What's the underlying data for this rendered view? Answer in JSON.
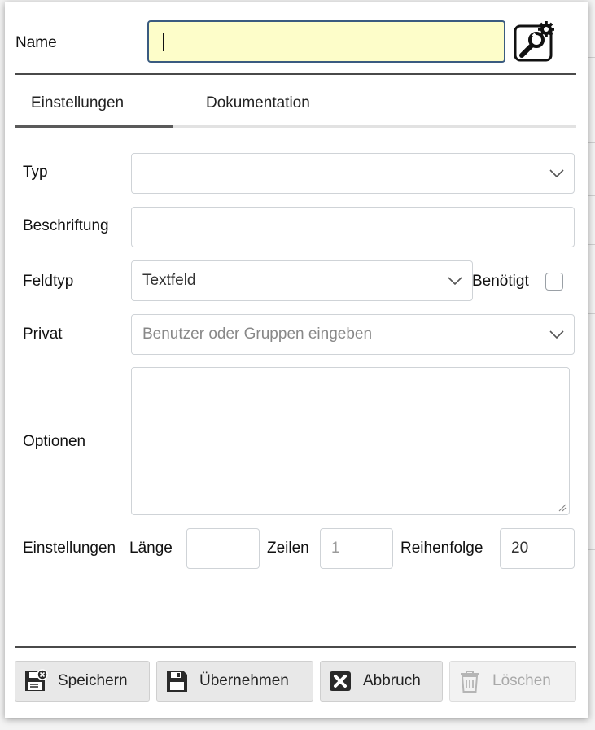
{
  "dialog": {
    "name_label": "Name",
    "name_value": "",
    "tool_icon": "wrench-gear-icon"
  },
  "tabs": [
    {
      "label": "Einstellungen",
      "active": true
    },
    {
      "label": "Dokumentation",
      "active": false
    }
  ],
  "fields": {
    "typ": {
      "label": "Typ",
      "value": ""
    },
    "beschriftung": {
      "label": "Beschriftung",
      "value": ""
    },
    "feldtyp": {
      "label": "Feldtyp",
      "value": "Textfeld"
    },
    "benoetigt": {
      "label": "Benötigt",
      "checked": false
    },
    "privat": {
      "label": "Privat",
      "placeholder": "Benutzer oder Gruppen eingeben"
    },
    "optionen": {
      "label": "Optionen",
      "value": ""
    },
    "einstellungen": {
      "label": "Einstellungen"
    },
    "laenge": {
      "label": "Länge",
      "value": ""
    },
    "zeilen": {
      "label": "Zeilen",
      "value": "1"
    },
    "reihenfolge": {
      "label": "Reihenfolge",
      "value": "20"
    }
  },
  "buttons": {
    "speichern": {
      "label": "Speichern",
      "icon": "save-icon"
    },
    "uebernehmen": {
      "label": "Übernehmen",
      "icon": "floppy-icon"
    },
    "abbruch": {
      "label": "Abbruch",
      "icon": "cancel-x-icon"
    },
    "loeschen": {
      "label": "Löschen",
      "icon": "trash-icon",
      "disabled": true
    }
  },
  "colors": {
    "name_input_bg": "#fdfdc9",
    "name_input_border": "#3a5b80",
    "button_bg": "#e8e8e8"
  }
}
